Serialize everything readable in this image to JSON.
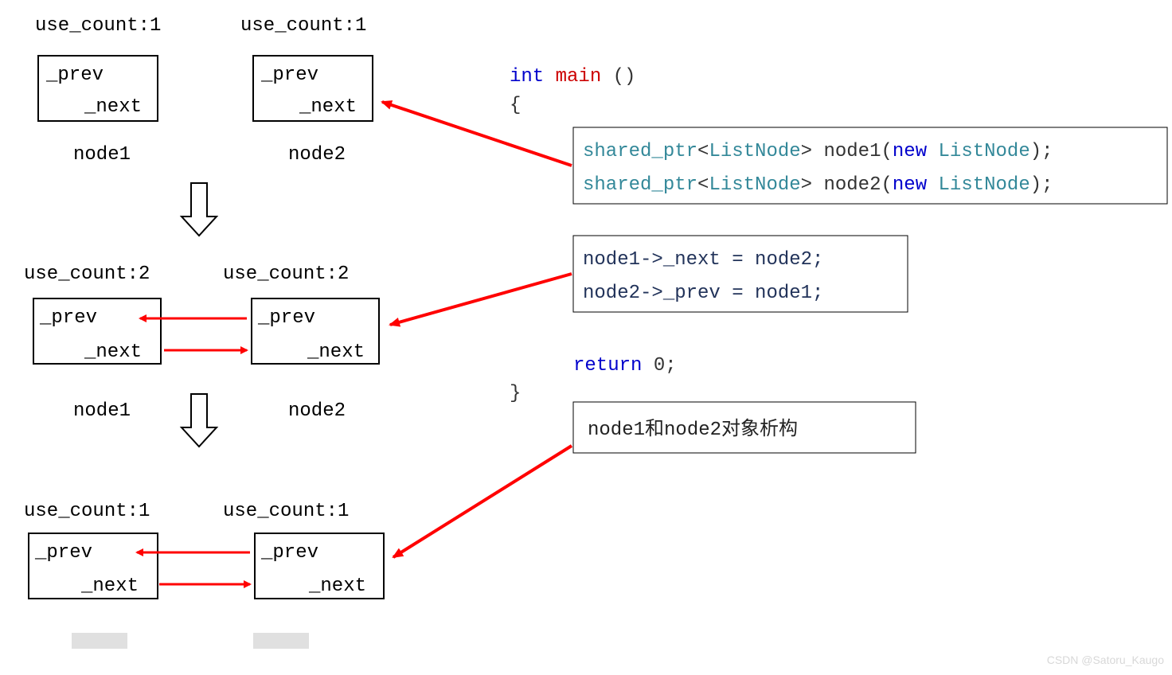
{
  "diagram": {
    "stages": [
      {
        "use_count1": "use_count:1",
        "use_count2": "use_count:1",
        "node1_prev": "_prev",
        "node1_next": "_next",
        "node2_prev": "_prev",
        "node2_next": "_next",
        "label1": "node1",
        "label2": "node2"
      },
      {
        "use_count1": "use_count:2",
        "use_count2": "use_count:2",
        "node1_prev": "_prev",
        "node1_next": "_next",
        "node2_prev": "_prev",
        "node2_next": "_next",
        "label1": "node1",
        "label2": "node2"
      },
      {
        "use_count1": "use_count:1",
        "use_count2": "use_count:1",
        "node1_prev": "_prev",
        "node1_next": "_next",
        "node2_prev": "_prev",
        "node2_next": "_next"
      }
    ]
  },
  "code": {
    "sig_int": "int",
    "sig_main": "main",
    "sig_parens": "()",
    "brace_open": "{",
    "line1": {
      "t1": "shared_ptr",
      "angle_open": "<",
      "t2": "ListNode",
      "angle_close": ">",
      "t3": " node1",
      "paren_open": "(",
      "kw_new": "new",
      "t4": " ListNode",
      "paren_close": ")",
      "semi": ";"
    },
    "line2": {
      "t1": "shared_ptr",
      "angle_open": "<",
      "t2": "ListNode",
      "angle_close": ">",
      "t3": " node2",
      "paren_open": "(",
      "kw_new": "new",
      "t4": " ListNode",
      "paren_close": ")",
      "semi": ";"
    },
    "line3": "node1->_next = node2;",
    "line4": "node2->_prev = node1;",
    "kw_return": "return",
    "ret_zero": " 0;",
    "brace_close": "}",
    "destruct_note": "node1和node2对象析构"
  },
  "watermark": "CSDN @Satoru_Kaugo"
}
